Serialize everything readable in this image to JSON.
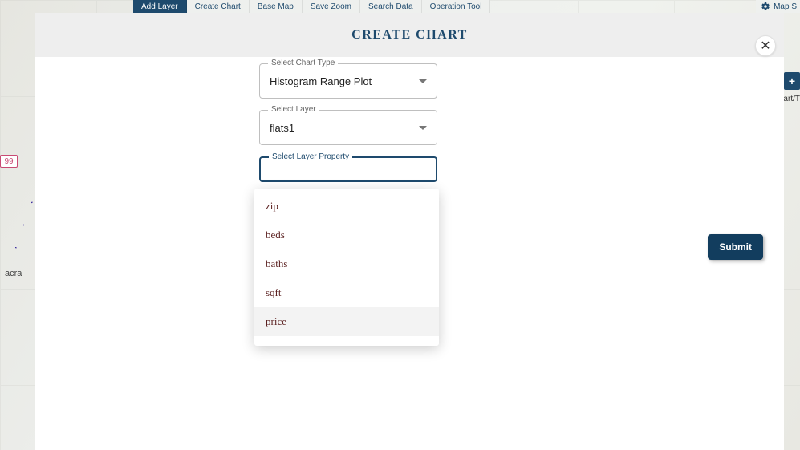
{
  "toolbar": {
    "items": [
      {
        "label": "Add Layer",
        "active": true
      },
      {
        "label": "Create Chart",
        "active": false
      },
      {
        "label": "Base Map",
        "active": false
      },
      {
        "label": "Save Zoom",
        "active": false
      },
      {
        "label": "Search Data",
        "active": false
      },
      {
        "label": "Operation Tool",
        "active": false
      }
    ],
    "map_settings": "Map S"
  },
  "map": {
    "route_badge": "99",
    "city_label_fragment": "acra",
    "right_add_tooltip": "hart/T"
  },
  "modal": {
    "title": "CREATE CHART",
    "close_label": "✕",
    "submit_label": "Submit",
    "fields": {
      "chart_type": {
        "label": "Select Chart Type",
        "value": "Histogram Range Plot"
      },
      "layer": {
        "label": "Select Layer",
        "value": "flats1"
      },
      "layer_property": {
        "label": "Select Layer Property",
        "value": ""
      }
    },
    "property_options": [
      {
        "label": "zip",
        "hover": false
      },
      {
        "label": "beds",
        "hover": false
      },
      {
        "label": "baths",
        "hover": false
      },
      {
        "label": "sqft",
        "hover": false
      },
      {
        "label": "price",
        "hover": true
      }
    ]
  }
}
